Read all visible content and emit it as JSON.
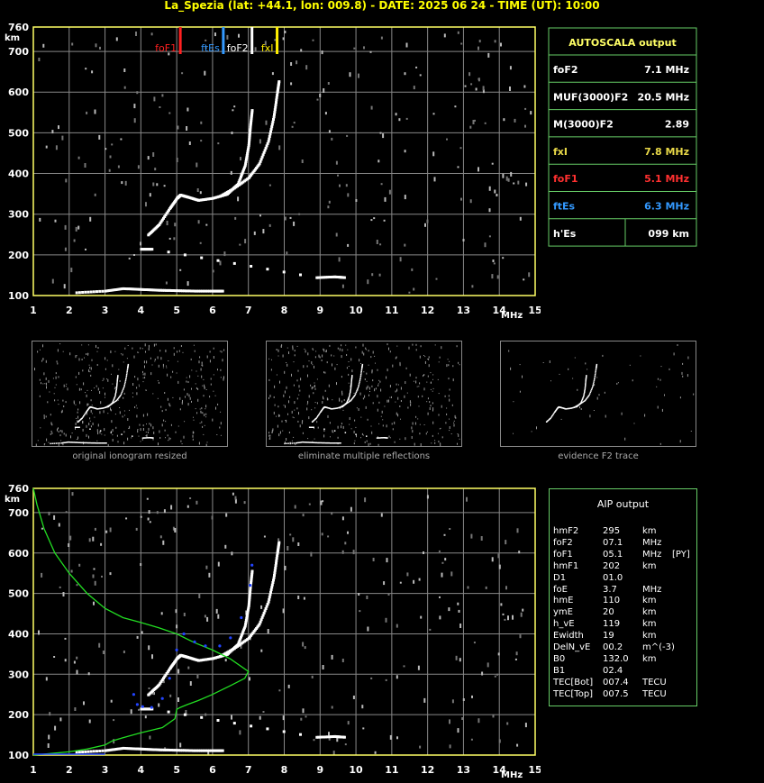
{
  "header": "La_Spezia (lat: +44.1, lon: 009.8) - DATE: 2025 06 24 - TIME (UT): 10:00",
  "colors": {
    "axis": "#ffff66",
    "grid": "#888888",
    "trace": "#ffffff",
    "foF1": "#ff2020",
    "ftEs": "#3399ff",
    "foF2": "#ffffff",
    "fxI": "#ffee00",
    "table_border": "#66cc66",
    "profile": "#22dd22",
    "aip_points": "#2244ff"
  },
  "autoscala": {
    "title": "AUTOSCALA output",
    "rows": [
      {
        "label": "foF2",
        "value": "7.1 MHz",
        "color": "#ffffff"
      },
      {
        "label": "MUF(3000)F2",
        "value": "20.5 MHz",
        "color": "#ffffff"
      },
      {
        "label": "M(3000)F2",
        "value": "2.89",
        "color": "#ffffff"
      },
      {
        "label": "fxI",
        "value": "7.8 MHz",
        "color": "#e8d848"
      },
      {
        "label": "foF1",
        "value": "5.1 MHz",
        "color": "#ff3030"
      },
      {
        "label": "ftEs",
        "value": "6.3 MHz",
        "color": "#3399ff"
      },
      {
        "label": "h'Es",
        "value": "099     km",
        "color": "#ffffff"
      }
    ]
  },
  "aip": {
    "title": "AIP output",
    "rows": [
      {
        "name": "hmF2",
        "val": "295",
        "unit": "km",
        "extra": ""
      },
      {
        "name": "foF2",
        "val": "07.1",
        "unit": "MHz",
        "extra": ""
      },
      {
        "name": "foF1",
        "val": "05.1",
        "unit": "MHz",
        "extra": "[PY]"
      },
      {
        "name": "hmF1",
        "val": "202",
        "unit": "km",
        "extra": ""
      },
      {
        "name": "D1",
        "val": "01.0",
        "unit": "",
        "extra": ""
      },
      {
        "name": "foE",
        "val": "3.7",
        "unit": "MHz",
        "extra": ""
      },
      {
        "name": "hmE",
        "val": "110",
        "unit": "km",
        "extra": ""
      },
      {
        "name": "ymE",
        "val": "20",
        "unit": "km",
        "extra": ""
      },
      {
        "name": "h_vE",
        "val": "119",
        "unit": "km",
        "extra": ""
      },
      {
        "name": "Ewidth",
        "val": "19",
        "unit": "km",
        "extra": ""
      },
      {
        "name": "DelN_vE",
        "val": "00.2",
        "unit": "m^(-3)",
        "extra": ""
      },
      {
        "name": "B0",
        "val": "132.0",
        "unit": "km",
        "extra": ""
      },
      {
        "name": "B1",
        "val": "02.4",
        "unit": "",
        "extra": ""
      },
      {
        "name": "TEC[Bot]",
        "val": "007.4",
        "unit": "TECU",
        "extra": ""
      },
      {
        "name": "TEC[Top]",
        "val": "007.5",
        "unit": "TECU",
        "extra": ""
      }
    ]
  },
  "thumbnails": [
    {
      "caption": "original ionogram resized"
    },
    {
      "caption": "eliminate multiple reflections"
    },
    {
      "caption": "evidence F2 trace"
    }
  ],
  "chart_data": [
    {
      "type": "scatter",
      "title": "",
      "xlabel": "MHz",
      "ylabel": "km",
      "xlim": [
        1,
        15
      ],
      "ylim": [
        100,
        760
      ],
      "x_ticks": [
        1,
        2,
        3,
        4,
        5,
        6,
        7,
        8,
        9,
        10,
        11,
        12,
        13,
        14,
        15
      ],
      "y_ticks": [
        100,
        200,
        300,
        400,
        500,
        600,
        700,
        760
      ],
      "grid": true,
      "markers": [
        {
          "label": "foF1",
          "x": 5.1,
          "color": "#ff2020"
        },
        {
          "label": "ftEs",
          "x": 6.3,
          "color": "#3399ff"
        },
        {
          "label": "foF2",
          "x": 7.1,
          "color": "#ffffff"
        },
        {
          "label": "fxI",
          "x": 7.8,
          "color": "#ffee00"
        }
      ],
      "series": [
        {
          "values": [
            [
              4.2,
              250
            ],
            [
              4.5,
              275
            ],
            [
              4.8,
              315
            ],
            [
              5.0,
              340
            ],
            [
              5.1,
              348
            ],
            [
              5.3,
              343
            ],
            [
              5.6,
              335
            ],
            [
              6.0,
              340
            ],
            [
              6.4,
              350
            ],
            [
              6.7,
              375
            ],
            [
              6.9,
              420
            ],
            [
              7.0,
              470
            ],
            [
              7.05,
              520
            ],
            [
              7.1,
              560
            ]
          ]
        },
        {
          "values": [
            [
              6.2,
              345
            ],
            [
              6.6,
              365
            ],
            [
              7.0,
              390
            ],
            [
              7.3,
              425
            ],
            [
              7.55,
              480
            ],
            [
              7.7,
              540
            ],
            [
              7.8,
              600
            ],
            [
              7.85,
              630
            ]
          ]
        },
        {
          "values": [
            [
              2.2,
              108
            ],
            [
              3.0,
              112
            ],
            [
              3.5,
              118
            ],
            [
              4.0,
              116
            ],
            [
              4.5,
              114
            ],
            [
              5.0,
              113
            ],
            [
              5.5,
              112
            ],
            [
              6.0,
              112
            ],
            [
              6.3,
              112
            ]
          ]
        },
        {
          "values": [
            [
              4.0,
              215
            ],
            [
              4.3,
              215
            ],
            [
              8.9,
              145
            ],
            [
              9.4,
              147
            ],
            [
              9.7,
              145
            ]
          ]
        }
      ]
    },
    {
      "type": "line",
      "title": "",
      "xlabel": "MHz",
      "ylabel": "km",
      "xlim": [
        1,
        15
      ],
      "ylim": [
        100,
        760
      ],
      "x_ticks": [
        1,
        2,
        3,
        4,
        5,
        6,
        7,
        8,
        9,
        10,
        11,
        12,
        13,
        14,
        15
      ],
      "y_ticks": [
        100,
        200,
        300,
        400,
        500,
        600,
        700,
        760
      ],
      "grid": true,
      "series": [
        {
          "values": [
            [
              1.0,
              760
            ],
            [
              1.1,
              720
            ],
            [
              1.3,
              660
            ],
            [
              1.6,
              600
            ],
            [
              2.0,
              550
            ],
            [
              2.5,
              500
            ],
            [
              3.0,
              463
            ],
            [
              3.5,
              440
            ],
            [
              4.0,
              428
            ],
            [
              4.5,
              415
            ],
            [
              5.0,
              400
            ],
            [
              5.5,
              378
            ],
            [
              6.0,
              360
            ],
            [
              6.5,
              338
            ],
            [
              7.0,
              307
            ],
            [
              6.9,
              290
            ],
            [
              6.5,
              272
            ],
            [
              6.0,
              250
            ],
            [
              5.6,
              235
            ],
            [
              5.3,
              225
            ],
            [
              5.1,
              218
            ],
            [
              5.0,
              213
            ],
            [
              4.95,
              190
            ],
            [
              4.6,
              168
            ],
            [
              4.0,
              155
            ],
            [
              3.5,
              143
            ],
            [
              3.2,
              135
            ],
            [
              3.0,
              125
            ],
            [
              2.5,
              115
            ],
            [
              2.0,
              108
            ],
            [
              1.5,
              104
            ],
            [
              1.0,
              100
            ]
          ]
        },
        {
          "values": [
            [
              3.8,
              250
            ],
            [
              3.9,
              225
            ],
            [
              4.05,
              220
            ],
            [
              4.3,
              218
            ],
            [
              4.6,
              240
            ],
            [
              4.8,
              290
            ],
            [
              5.0,
              360
            ],
            [
              5.2,
              400
            ],
            [
              5.5,
              380
            ],
            [
              5.8,
              370
            ],
            [
              6.2,
              370
            ],
            [
              6.5,
              390
            ],
            [
              6.8,
              440
            ],
            [
              7.05,
              520
            ],
            [
              7.1,
              570
            ]
          ]
        }
      ]
    }
  ]
}
